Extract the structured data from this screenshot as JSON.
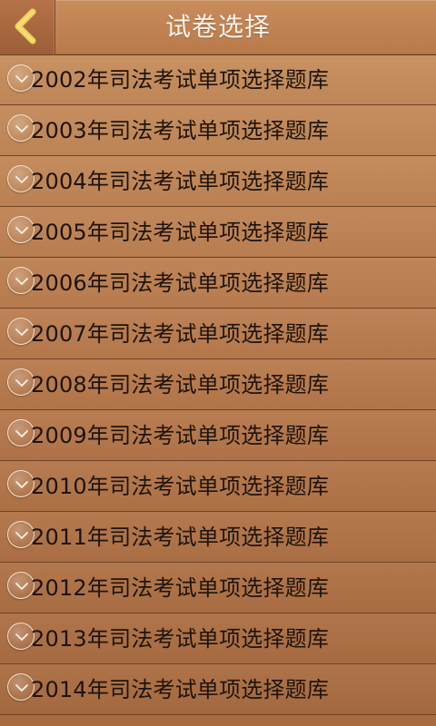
{
  "header": {
    "title": "试卷选择",
    "back_icon": "chevron-left-icon"
  },
  "items": [
    {
      "label": "2002年司法考试单项选择题库",
      "icon": "chevron-down-icon"
    },
    {
      "label": "2003年司法考试单项选择题库",
      "icon": "chevron-down-icon"
    },
    {
      "label": "2004年司法考试单项选择题库",
      "icon": "chevron-down-icon"
    },
    {
      "label": "2005年司法考试单项选择题库",
      "icon": "chevron-down-icon"
    },
    {
      "label": "2006年司法考试单项选择题库",
      "icon": "chevron-down-icon"
    },
    {
      "label": "2007年司法考试单项选择题库",
      "icon": "chevron-down-icon"
    },
    {
      "label": "2008年司法考试单项选择题库",
      "icon": "chevron-down-icon"
    },
    {
      "label": "2009年司法考试单项选择题库",
      "icon": "chevron-down-icon"
    },
    {
      "label": "2010年司法考试单项选择题库",
      "icon": "chevron-down-icon"
    },
    {
      "label": "2011年司法考试单项选择题库",
      "icon": "chevron-down-icon"
    },
    {
      "label": "2012年司法考试单项选择题库",
      "icon": "chevron-down-icon"
    },
    {
      "label": "2013年司法考试单项选择题库",
      "icon": "chevron-down-icon"
    },
    {
      "label": "2014年司法考试单项选择题库",
      "icon": "chevron-down-icon"
    }
  ],
  "colors": {
    "background": "#b97a4e",
    "header_back_button": "#9b5f37",
    "title_text": "#f8f2ea",
    "item_text": "#1f140c",
    "divider": "#6e4328",
    "back_chevron": "#f2d35b"
  }
}
